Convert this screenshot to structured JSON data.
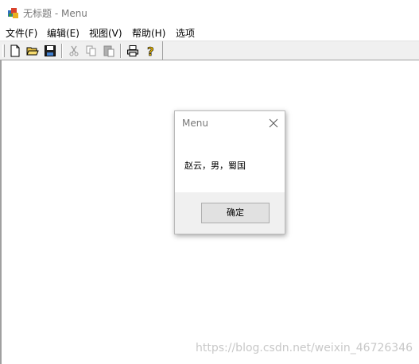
{
  "window": {
    "title": "无标题 - Menu"
  },
  "menubar": {
    "items": [
      "文件(F)",
      "编辑(E)",
      "视图(V)",
      "帮助(H)",
      "选项"
    ]
  },
  "toolbar": {
    "buttons": [
      "new-file-icon",
      "open-folder-icon",
      "save-icon",
      "cut-icon",
      "copy-icon",
      "paste-icon",
      "print-icon",
      "help-icon"
    ]
  },
  "dialog": {
    "title": "Menu",
    "message": "赵云，男，蜀国",
    "ok_label": "确定"
  },
  "watermark": "https://blog.csdn.net/weixin_46726346"
}
